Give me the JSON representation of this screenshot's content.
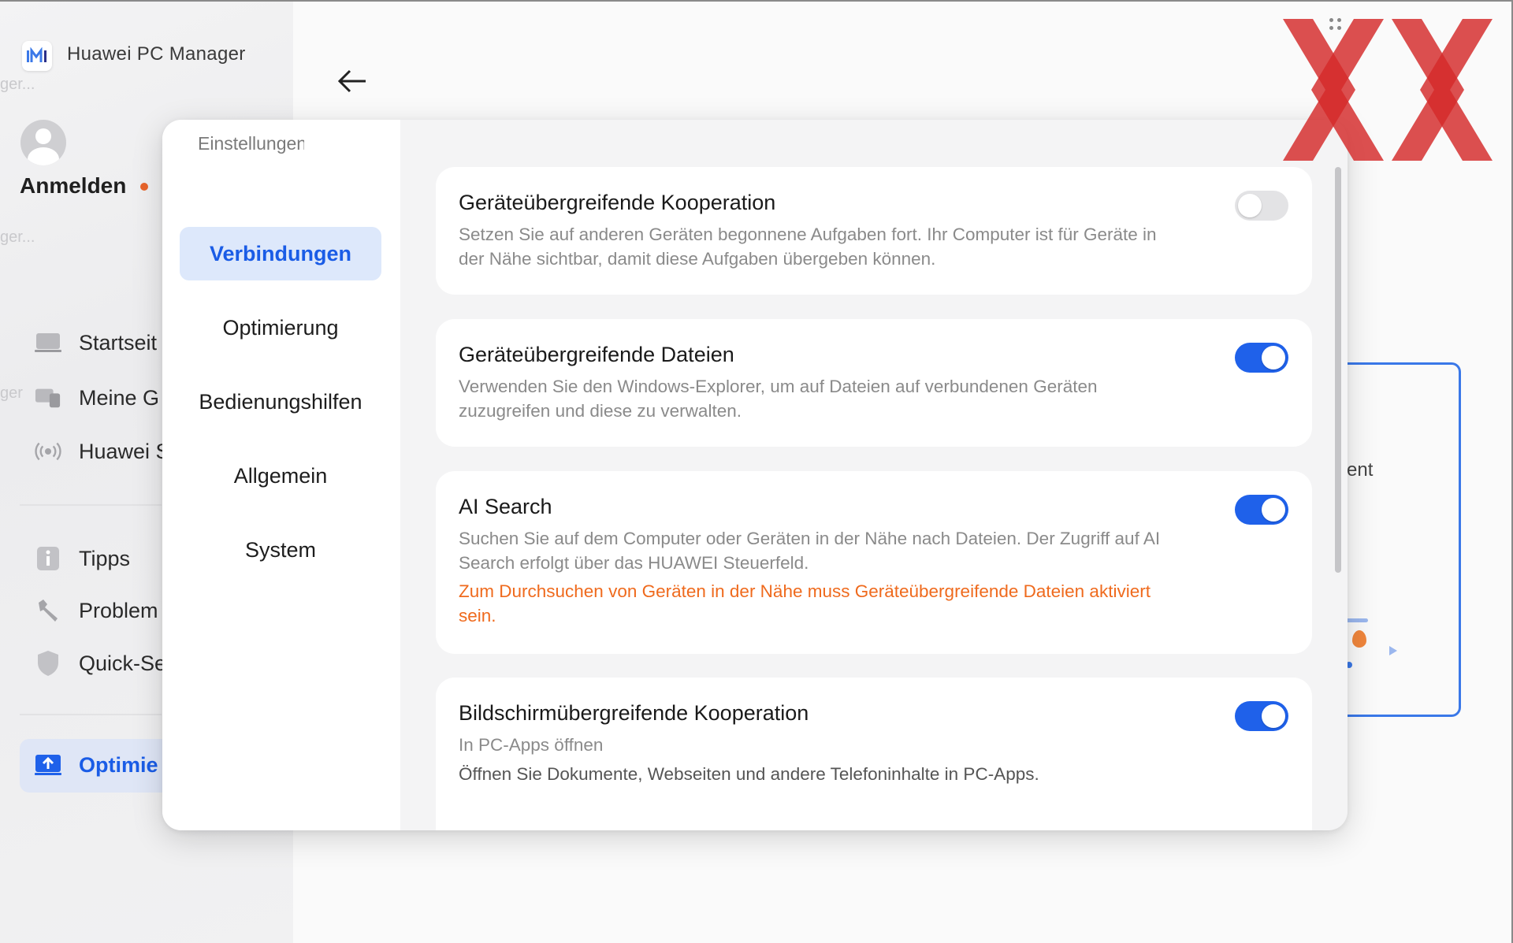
{
  "app": {
    "title": "Huawei PC Manager",
    "ghost_text_1": "ger...",
    "ghost_text_2": "ger...",
    "ghost_text_3": "ger"
  },
  "account": {
    "login_label": "Anmelden"
  },
  "sidebar": {
    "items": [
      {
        "label": "Startseit",
        "icon": "laptop-icon"
      },
      {
        "label": "Meine G",
        "icon": "devices-icon"
      },
      {
        "label": "Huawei S",
        "icon": "wireless-icon"
      },
      {
        "label": "Tipps",
        "icon": "info-icon"
      },
      {
        "label": "Problem",
        "icon": "wrench-icon"
      },
      {
        "label": "Quick-Se",
        "icon": "shield-icon"
      },
      {
        "label": "Optimie",
        "icon": "optimize-icon"
      }
    ]
  },
  "background": {
    "partial_text": "ent"
  },
  "settings": {
    "title": "Einstellungen",
    "tabs": [
      {
        "label": "Verbindungen",
        "active": true
      },
      {
        "label": "Optimierung",
        "active": false
      },
      {
        "label": "Bedienungshilfen",
        "active": false
      },
      {
        "label": "Allgemein",
        "active": false
      },
      {
        "label": "System",
        "active": false
      }
    ],
    "cards": [
      {
        "title": "Geräteübergreifende Kooperation",
        "description": "Setzen Sie auf anderen Geräten begonnene Aufgaben fort. Ihr Computer ist für Geräte in der Nähe sichtbar, damit diese Aufgaben übergeben können.",
        "enabled": false
      },
      {
        "title": "Geräteübergreifende Dateien",
        "description": "Verwenden Sie den Windows-Explorer, um auf Dateien auf verbundenen Geräten zuzugreifen und diese zu verwalten.",
        "enabled": true
      },
      {
        "title": "AI Search",
        "description": "Suchen Sie auf dem Computer oder Geräten in der Nähe nach Dateien. Der Zugriff auf AI Search erfolgt über das HUAWEI Steuerfeld.",
        "warning": "Zum Durchsuchen von Geräten in der Nähe muss Geräteübergreifende Dateien aktiviert sein.",
        "enabled": true
      },
      {
        "title": "Bildschirmübergreifende Kooperation",
        "subtitle": "In PC-Apps öffnen",
        "body": "Öffnen Sie Dokumente, Webseiten und andere Telefoninhalte in PC-Apps.",
        "enabled": true
      }
    ]
  },
  "colors": {
    "accent": "#1f61ea",
    "active_tab_bg": "#dde8fb",
    "warning": "#ef6a1d",
    "watermark": "#d42a2a"
  }
}
